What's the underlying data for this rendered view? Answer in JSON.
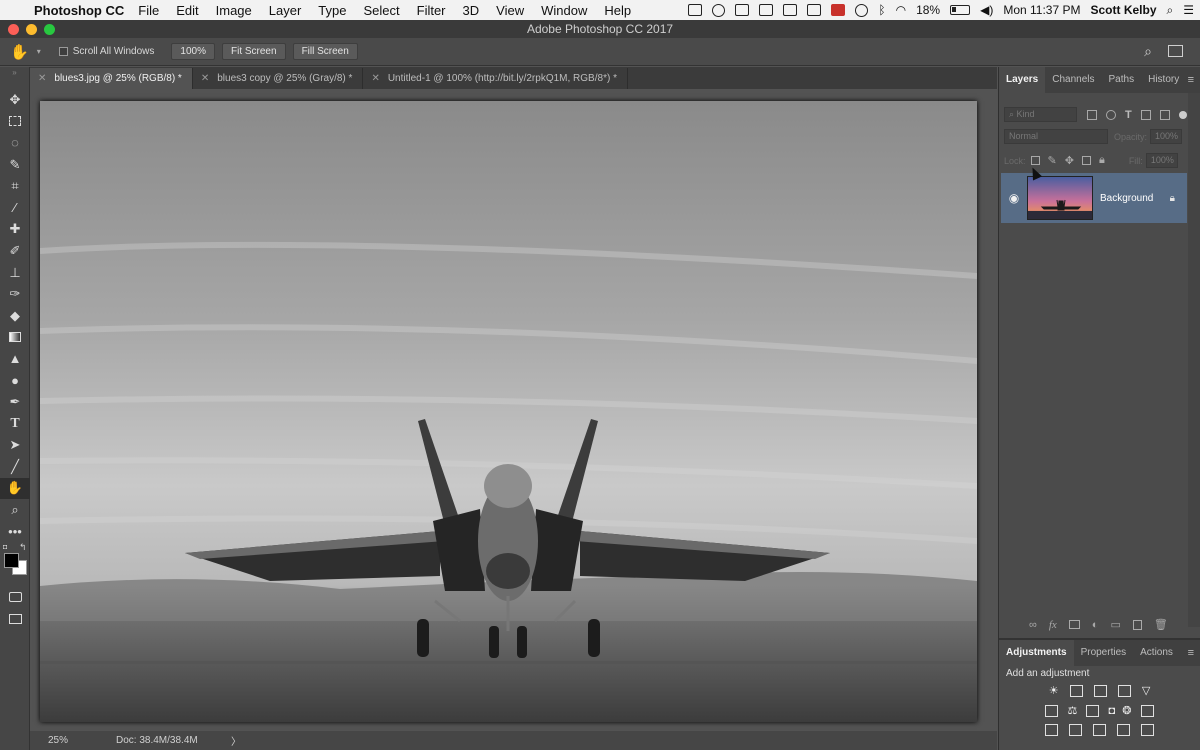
{
  "menubar": {
    "app_name": "Photoshop CC",
    "menus": [
      "File",
      "Edit",
      "Image",
      "Layer",
      "Type",
      "Select",
      "Filter",
      "3D",
      "View",
      "Window",
      "Help"
    ],
    "battery": "18%",
    "clock": "Mon 11:37 PM",
    "user": "Scott Kelby"
  },
  "window": {
    "title": "Adobe Photoshop CC 2017"
  },
  "options": {
    "scroll_all_label": "Scroll All Windows",
    "zoom_label": "100%",
    "fit_screen_label": "Fit Screen",
    "fill_screen_label": "Fill Screen"
  },
  "tabs": [
    {
      "label": "blues3.jpg @ 25% (RGB/8) *"
    },
    {
      "label": "blues3 copy @ 25% (Gray/8) *"
    },
    {
      "label": "Untitled-1 @ 100% (http://bit.ly/2rpkQ1M, RGB/8*) *"
    }
  ],
  "status": {
    "zoom": "25%",
    "doc": "Doc: 38.4M/38.4M",
    "arrow": "〉"
  },
  "layers_panel": {
    "tabs": [
      "Layers",
      "Channels",
      "Paths",
      "History"
    ],
    "kind_placeholder": "Kind",
    "blend_mode": "Normal",
    "opacity_label": "Opacity:",
    "opacity_value": "100%",
    "lock_label": "Lock:",
    "fill_label": "Fill:",
    "fill_value": "100%",
    "layer_name": "Background",
    "footer_icons": [
      "link-icon",
      "fx-icon",
      "mask-icon",
      "adjustment-icon",
      "folder-icon",
      "new-layer-icon",
      "trash-icon"
    ],
    "fx_label": "fx"
  },
  "adjustments_panel": {
    "tabs": [
      "Adjustments",
      "Properties",
      "Actions"
    ],
    "subtitle": "Add an adjustment"
  },
  "toolbar": {
    "tools": [
      "move-tool",
      "marquee-tool",
      "lasso-tool",
      "quick-select-tool",
      "crop-tool",
      "eyedropper-tool",
      "healing-tool",
      "brush-tool",
      "stamp-tool",
      "history-brush-tool",
      "eraser-tool",
      "gradient-tool",
      "blur-tool",
      "dodge-tool",
      "pen-tool",
      "type-tool",
      "path-select-tool",
      "line-tool",
      "hand-tool",
      "zoom-tool",
      "more-tools"
    ],
    "type_glyph": "T"
  },
  "colors": {
    "accent_layer": "#576c86",
    "panel_bg": "#4b4b4b",
    "workspace_bg": "#535353"
  }
}
